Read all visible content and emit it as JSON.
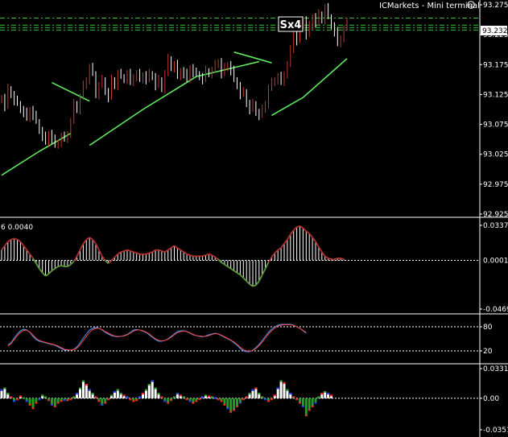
{
  "window": {
    "terminal_label": "ICMarkets - Mini terminal",
    "terminal_icon": "smiley-icon",
    "symbol_badge": "Sx4"
  },
  "colors": {
    "background": "#000000",
    "bull_candle": "#c0392b",
    "bear_candle": "#ffffff",
    "ma_line": "#5fe85f",
    "level_line": "#39c839",
    "grid": "#ffffff",
    "price_tag_bg": "#ffffff",
    "price_tag_fg": "#000000",
    "osc_up": "#b03030",
    "osc_down": "#5a9a3a",
    "osc_bar_white": "#ffffff",
    "stoch_main": "#3aa0ff",
    "stoch_signal": "#ff4040",
    "hist_up": "#ffffff",
    "hist_red": "#ff2020",
    "hist_blue": "#2040ff",
    "hist_green": "#20a020"
  },
  "chart_data": [
    {
      "type": "candlestick",
      "panel": "price",
      "ylim": [
        92.925,
        93.275
      ],
      "y_ticks": [
        "93.275",
        "93.225",
        "93.175",
        "93.125",
        "93.075",
        "93.025",
        "92.975",
        "92.925"
      ],
      "current_price": "93.232",
      "level_lines": [
        93.253,
        93.241,
        93.237,
        93.233
      ],
      "ma_segments": [
        {
          "points": [
            [
              0,
              92.99
            ],
            [
              12,
              93.03
            ],
            [
              22,
              93.06
            ]
          ]
        },
        {
          "points": [
            [
              16,
              93.145
            ],
            [
              28,
              93.114
            ]
          ]
        },
        {
          "points": [
            [
              28,
              93.04
            ],
            [
              45,
              93.1
            ],
            [
              62,
              93.155
            ],
            [
              74,
              93.17
            ],
            [
              82,
              93.18
            ]
          ]
        },
        {
          "points": [
            [
              74,
              93.196
            ],
            [
              86,
              93.178
            ]
          ]
        },
        {
          "points": [
            [
              86,
              93.09
            ],
            [
              96,
              93.12
            ],
            [
              110,
              93.185
            ]
          ]
        }
      ],
      "closes": [
        93.12,
        93.105,
        93.135,
        93.125,
        93.115,
        93.11,
        93.1,
        93.095,
        93.085,
        93.1,
        93.09,
        93.08,
        93.065,
        93.055,
        93.045,
        93.06,
        93.05,
        93.04,
        93.045,
        93.055,
        93.05,
        93.06,
        93.08,
        93.11,
        93.1,
        93.12,
        93.14,
        93.15,
        93.17,
        93.16,
        93.125,
        93.14,
        93.15,
        93.13,
        93.12,
        93.15,
        93.14,
        93.16,
        93.155,
        93.15,
        93.16,
        93.145,
        93.155,
        93.16,
        93.15,
        93.158,
        93.15,
        93.16,
        93.155,
        93.14,
        93.15,
        93.135,
        93.16,
        93.185,
        93.17,
        93.175,
        93.155,
        93.165,
        93.16,
        93.15,
        93.17,
        93.162,
        93.16,
        93.155,
        93.15,
        93.165,
        93.16,
        93.165,
        93.175,
        93.18,
        93.16,
        93.17,
        93.175,
        93.165,
        93.15,
        93.14,
        93.125,
        93.13,
        93.11,
        93.1,
        93.11,
        93.095,
        93.09,
        93.1,
        93.11,
        93.135,
        93.145,
        93.15,
        93.155,
        93.145,
        93.16,
        93.175,
        93.2,
        93.23,
        93.215,
        93.24,
        93.25,
        93.225,
        93.24,
        93.255,
        93.245,
        93.26,
        93.25,
        93.27,
        93.255,
        93.24,
        93.23,
        93.21,
        93.22,
        93.235,
        93.245
      ]
    },
    {
      "type": "bar",
      "panel": "oscillator",
      "label": "6  0.0040",
      "ylim": [
        -0.0469,
        0.0337
      ],
      "y_ticks": [
        "0.0337",
        "0.0000",
        "-0.0469"
      ],
      "current_value": "0.0001",
      "values": [
        0.01,
        0.014,
        0.018,
        0.02,
        0.021,
        0.02,
        0.018,
        0.014,
        0.01,
        0.006,
        0.002,
        -0.003,
        -0.008,
        -0.012,
        -0.015,
        -0.013,
        -0.01,
        -0.008,
        -0.006,
        -0.005,
        -0.006,
        -0.006,
        -0.004,
        -0.001,
        0.004,
        0.01,
        0.016,
        0.02,
        0.022,
        0.02,
        0.016,
        0.01,
        0.004,
        0.0,
        -0.003,
        0.0,
        0.003,
        0.006,
        0.008,
        0.009,
        0.01,
        0.009,
        0.008,
        0.007,
        0.006,
        0.006,
        0.006,
        0.007,
        0.008,
        0.01,
        0.01,
        0.009,
        0.008,
        0.01,
        0.012,
        0.014,
        0.012,
        0.01,
        0.008,
        0.006,
        0.005,
        0.004,
        0.004,
        0.004,
        0.004,
        0.005,
        0.006,
        0.005,
        0.003,
        0.001,
        -0.002,
        -0.004,
        -0.006,
        -0.008,
        -0.01,
        -0.012,
        -0.014,
        -0.017,
        -0.02,
        -0.023,
        -0.025,
        -0.024,
        -0.02,
        -0.014,
        -0.008,
        -0.002,
        0.003,
        0.007,
        0.01,
        0.012,
        0.016,
        0.02,
        0.025,
        0.029,
        0.032,
        0.033,
        0.031,
        0.028,
        0.026,
        0.022,
        0.018,
        0.013,
        0.008,
        0.004,
        0.002,
        0.001,
        0.001,
        0.002,
        0.002,
        0.001
      ]
    },
    {
      "type": "line",
      "panel": "stochastic",
      "ylim": [
        0,
        100
      ],
      "levels": [
        80,
        20
      ],
      "y_ticks": [
        "80",
        "20"
      ],
      "series": [
        {
          "color_key": "stoch_main",
          "values": [
            35,
            40,
            52,
            62,
            70,
            74,
            72,
            66,
            56,
            48,
            44,
            42,
            40,
            38,
            36,
            34,
            30,
            26,
            22,
            22,
            22,
            24,
            30,
            40,
            52,
            62,
            72,
            76,
            78,
            76,
            72,
            66,
            62,
            58,
            56,
            55,
            56,
            58,
            61,
            66,
            72,
            73,
            72,
            69,
            66,
            60,
            54,
            48,
            44,
            44,
            46,
            50,
            56,
            62,
            68,
            70,
            70,
            68,
            64,
            60,
            58,
            56,
            55,
            57,
            60,
            62,
            64,
            62,
            58,
            54,
            50,
            46,
            40,
            34,
            26,
            20,
            18,
            18,
            22,
            28,
            36,
            46,
            56,
            66,
            74,
            80,
            84,
            86,
            86,
            86,
            86,
            84,
            80,
            76,
            70,
            64
          ]
        },
        {
          "color_key": "stoch_signal",
          "values": [
            32,
            38,
            48,
            58,
            66,
            71,
            71,
            67,
            59,
            51,
            46,
            43,
            41,
            39,
            37,
            35,
            32,
            28,
            24,
            23,
            22,
            23,
            27,
            35,
            46,
            56,
            66,
            73,
            76,
            76,
            73,
            68,
            64,
            60,
            57,
            56,
            56,
            57,
            60,
            64,
            69,
            72,
            72,
            70,
            67,
            62,
            56,
            50,
            46,
            45,
            46,
            49,
            54,
            60,
            65,
            68,
            69,
            68,
            65,
            61,
            58,
            57,
            56,
            56,
            58,
            61,
            63,
            62,
            59,
            55,
            51,
            47,
            42,
            36,
            29,
            23,
            20,
            19,
            21,
            26,
            33,
            42,
            52,
            62,
            70,
            77,
            82,
            84,
            85,
            85,
            85,
            83,
            80,
            76,
            71,
            66
          ]
        }
      ]
    },
    {
      "type": "bar",
      "panel": "histogram",
      "ylim": [
        -0.0351,
        0.0331
      ],
      "y_ticks": [
        "0.0331",
        "0.00",
        "-0.0351"
      ],
      "values": [
        0.01,
        0.012,
        0.006,
        0.002,
        -0.004,
        -0.002,
        0.003,
        0.001,
        -0.004,
        -0.008,
        -0.012,
        -0.006,
        -0.002,
        0.004,
        0.002,
        -0.003,
        -0.008,
        -0.01,
        -0.006,
        -0.004,
        -0.003,
        -0.003,
        -0.002,
        0.002,
        0.006,
        0.012,
        0.02,
        0.016,
        0.01,
        0.006,
        0.002,
        -0.004,
        -0.008,
        -0.006,
        -0.002,
        0.004,
        0.008,
        0.01,
        0.006,
        0.004,
        0.002,
        -0.002,
        -0.004,
        -0.003,
        0.002,
        0.006,
        0.01,
        0.016,
        0.02,
        0.012,
        0.006,
        0.002,
        -0.004,
        -0.006,
        -0.003,
        0.002,
        0.006,
        0.004,
        0.002,
        -0.002,
        -0.004,
        -0.006,
        -0.004,
        0.0,
        0.002,
        0.004,
        0.003,
        0.002,
        0.001,
        -0.002,
        -0.004,
        -0.008,
        -0.012,
        -0.016,
        -0.014,
        -0.01,
        -0.006,
        -0.002,
        0.002,
        0.006,
        0.01,
        0.012,
        0.006,
        0.002,
        -0.002,
        -0.004,
        -0.002,
        0.004,
        0.012,
        0.02,
        0.018,
        0.01,
        0.006,
        0.002,
        -0.002,
        -0.006,
        -0.01,
        -0.02,
        -0.014,
        -0.01,
        -0.006,
        0.002,
        0.006,
        0.008,
        0.006,
        0.004
      ]
    }
  ]
}
